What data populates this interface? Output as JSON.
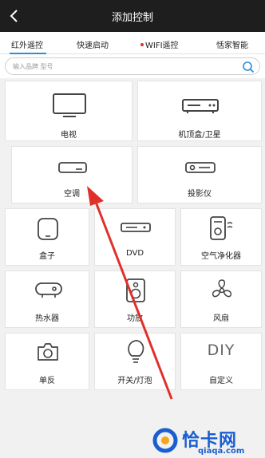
{
  "header": {
    "title": "添加控制",
    "back_icon": "chevron-left-icon"
  },
  "tabs": [
    {
      "label": "红外遥控",
      "active": true
    },
    {
      "label": "快速启动",
      "active": false
    },
    {
      "label": "WIFI遥控",
      "active": false,
      "badge": "red-dot"
    },
    {
      "label": "恬家智能",
      "active": false
    }
  ],
  "search": {
    "placeholder": "输入品牌 型号",
    "icon": "search-icon"
  },
  "devices": {
    "tv": {
      "label": "电视",
      "icon": "tv-icon"
    },
    "stb": {
      "label": "机顶盒/卫星",
      "icon": "set-top-box-icon"
    },
    "ac": {
      "label": "空调",
      "icon": "air-conditioner-icon"
    },
    "projector": {
      "label": "投影仪",
      "icon": "projector-icon"
    },
    "box": {
      "label": "盒子",
      "icon": "media-box-icon"
    },
    "dvd": {
      "label": "DVD",
      "icon": "dvd-player-icon"
    },
    "purifier": {
      "label": "空气净化器",
      "icon": "air-purifier-icon"
    },
    "heater": {
      "label": "热水器",
      "icon": "water-heater-icon"
    },
    "amp": {
      "label": "功放",
      "icon": "speaker-icon"
    },
    "fan": {
      "label": "风扇",
      "icon": "fan-icon"
    },
    "camera": {
      "label": "单反",
      "icon": "camera-icon"
    },
    "switch": {
      "label": "开关/灯泡",
      "icon": "light-bulb-icon"
    },
    "diy": {
      "label": "自定义",
      "icon_text": "DIY"
    }
  },
  "colors": {
    "accent": "#2a8fd8",
    "annotation_arrow": "#e0302a",
    "header_bg": "#1e1e1e",
    "watermark": "#1a5fd0"
  },
  "watermark": {
    "name": "恰卡网",
    "url": "qiaqa.com"
  }
}
